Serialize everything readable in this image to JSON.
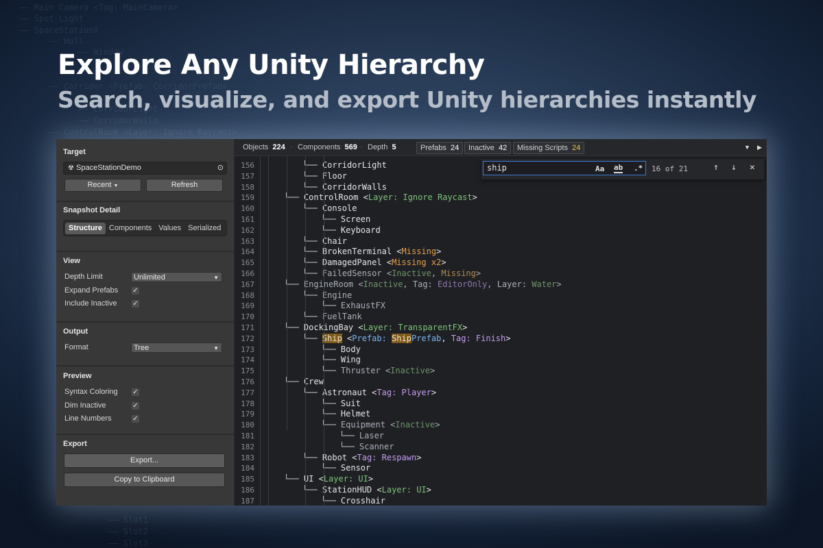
{
  "background_tree": [
    "—— Main Camera <Tag: MainCamera>",
    "—— Spot Light",
    "—— SpaceStationX",
    "      —— Hull",
    "            —— Window",
    "      —— Corridor <Prefab: CorridorPrefab>",
    "            —— CorridorLight",
    "            —— CorridorWalls",
    "      —— ControlRoom <Layer: Ignore Raycast>",
    "                  —— Slot1",
    "                  —— Slot2",
    "                  —— Slot3"
  ],
  "hero": {
    "title": "Explore Any Unity Hierarchy",
    "subtitle": "Search, visualize, and export Unity hierarchies instantly"
  },
  "sidebar": {
    "target": {
      "title": "Target",
      "object": "SpaceStationDemo",
      "recent_label": "Recent",
      "refresh_label": "Refresh"
    },
    "snapshot": {
      "title": "Snapshot Detail",
      "tabs": [
        "Structure",
        "Components",
        "Values",
        "Serialized"
      ],
      "active": "Structure"
    },
    "view": {
      "title": "View",
      "depth_label": "Depth Limit",
      "depth_value": "Unlimited",
      "expand_prefabs_label": "Expand Prefabs",
      "include_inactive_label": "Include Inactive"
    },
    "output": {
      "title": "Output",
      "format_label": "Format",
      "format_value": "Tree"
    },
    "preview": {
      "title": "Preview",
      "syntax_label": "Syntax Coloring",
      "dim_label": "Dim Inactive",
      "line_numbers_label": "Line Numbers"
    },
    "export": {
      "title": "Export",
      "export_label": "Export...",
      "copy_label": "Copy to Clipboard"
    },
    "checkmark": "✓"
  },
  "toolbar": {
    "objects_label": "Objects",
    "objects_value": "224",
    "components_label": "Components",
    "components_value": "569",
    "depth_label": "Depth",
    "depth_value": "5",
    "prefabs_label": "Prefabs",
    "prefabs_value": "24",
    "inactive_label": "Inactive",
    "inactive_value": "42",
    "missing_label": "Missing Scripts",
    "missing_value": "24",
    "separator": "·"
  },
  "find": {
    "query": "ship",
    "match_case": "Aa",
    "whole_word": "ab",
    "regex": ".*",
    "count": "16 of 21",
    "prev": "↑",
    "next": "↓",
    "close": "✕"
  },
  "colors": {
    "accent": "#3d7fd6",
    "green": "#7ec27a",
    "orange": "#e7a24a",
    "purple": "#c49bf0",
    "blue": "#79b4f0",
    "warning": "#e8c84a"
  },
  "lines": [
    {
      "n": "156",
      "d": 3,
      "seg": [
        [
          "t",
          "CorridorLight"
        ]
      ]
    },
    {
      "n": "157",
      "d": 3,
      "seg": [
        [
          "t",
          "Floor"
        ]
      ]
    },
    {
      "n": "158",
      "d": 3,
      "last": true,
      "seg": [
        [
          "t",
          "CorridorWalls"
        ]
      ]
    },
    {
      "n": "159",
      "d": 2,
      "seg": [
        [
          "t",
          "ControlRoom "
        ],
        [
          "p",
          "<"
        ],
        [
          "g",
          "Layer: Ignore Raycast"
        ],
        [
          "p",
          ">"
        ]
      ]
    },
    {
      "n": "160",
      "d": 3,
      "seg": [
        [
          "t",
          "Console"
        ]
      ]
    },
    {
      "n": "161",
      "d": 4,
      "seg": [
        [
          "t",
          "Screen"
        ]
      ]
    },
    {
      "n": "162",
      "d": 4,
      "last": true,
      "seg": [
        [
          "t",
          "Keyboard"
        ]
      ]
    },
    {
      "n": "163",
      "d": 3,
      "seg": [
        [
          "t",
          "Chair"
        ]
      ]
    },
    {
      "n": "164",
      "d": 3,
      "seg": [
        [
          "t",
          "BrokenTerminal "
        ],
        [
          "p",
          "<"
        ],
        [
          "o",
          "Missing"
        ],
        [
          "p",
          ">"
        ]
      ]
    },
    {
      "n": "165",
      "d": 3,
      "seg": [
        [
          "t",
          "DamagedPanel "
        ],
        [
          "p",
          "<"
        ],
        [
          "o",
          "Missing x2"
        ],
        [
          "p",
          ">"
        ]
      ]
    },
    {
      "n": "166",
      "d": 3,
      "last": true,
      "seg": [
        [
          "di",
          "FailedSensor "
        ],
        [
          "dp",
          "<"
        ],
        [
          "dg",
          "Inactive"
        ],
        [
          "dp",
          ", "
        ],
        [
          "do",
          "Missing"
        ],
        [
          "dp",
          ">"
        ]
      ]
    },
    {
      "n": "167",
      "d": 2,
      "seg": [
        [
          "di",
          "EngineRoom "
        ],
        [
          "dp",
          "<"
        ],
        [
          "dg",
          "Inactive"
        ],
        [
          "dp",
          ", Tag: "
        ],
        [
          "dpu",
          "EditorOnly"
        ],
        [
          "dp",
          ", Layer: "
        ],
        [
          "dg",
          "Water"
        ],
        [
          "dp",
          ">"
        ]
      ]
    },
    {
      "n": "168",
      "d": 3,
      "seg": [
        [
          "di",
          "Engine"
        ]
      ]
    },
    {
      "n": "169",
      "d": 4,
      "last": true,
      "seg": [
        [
          "di",
          "ExhaustFX"
        ]
      ]
    },
    {
      "n": "170",
      "d": 3,
      "last": true,
      "seg": [
        [
          "di",
          "FuelTank"
        ]
      ]
    },
    {
      "n": "171",
      "d": 2,
      "seg": [
        [
          "t",
          "DockingBay "
        ],
        [
          "p",
          "<"
        ],
        [
          "g",
          "Layer: TransparentFX"
        ],
        [
          "p",
          ">"
        ]
      ]
    },
    {
      "n": "172",
      "d": 3,
      "last": true,
      "seg": [
        [
          "hl",
          "Ship"
        ],
        [
          "p",
          " <"
        ],
        [
          "b",
          "Prefab: "
        ],
        [
          "hl",
          "Ship"
        ],
        [
          "b",
          "Prefab"
        ],
        [
          "p",
          ", "
        ],
        [
          "pu",
          "Tag: Finish"
        ],
        [
          "p",
          ">"
        ]
      ]
    },
    {
      "n": "173",
      "d": 4,
      "seg": [
        [
          "t",
          "Body"
        ]
      ]
    },
    {
      "n": "174",
      "d": 4,
      "seg": [
        [
          "t",
          "Wing"
        ]
      ]
    },
    {
      "n": "175",
      "d": 4,
      "last": true,
      "seg": [
        [
          "di",
          "Thruster "
        ],
        [
          "dp",
          "<"
        ],
        [
          "dg",
          "Inactive"
        ],
        [
          "dp",
          ">"
        ]
      ]
    },
    {
      "n": "176",
      "d": 2,
      "seg": [
        [
          "t",
          "Crew"
        ]
      ]
    },
    {
      "n": "177",
      "d": 3,
      "seg": [
        [
          "t",
          "Astronaut "
        ],
        [
          "p",
          "<"
        ],
        [
          "pu",
          "Tag: Player"
        ],
        [
          "p",
          ">"
        ]
      ]
    },
    {
      "n": "178",
      "d": 4,
      "seg": [
        [
          "t",
          "Suit"
        ]
      ]
    },
    {
      "n": "179",
      "d": 4,
      "seg": [
        [
          "t",
          "Helmet"
        ]
      ]
    },
    {
      "n": "180",
      "d": 4,
      "last": true,
      "seg": [
        [
          "di",
          "Equipment "
        ],
        [
          "dp",
          "<"
        ],
        [
          "dg",
          "Inactive"
        ],
        [
          "dp",
          ">"
        ]
      ]
    },
    {
      "n": "181",
      "d": 5,
      "seg": [
        [
          "di",
          "Laser"
        ]
      ]
    },
    {
      "n": "182",
      "d": 5,
      "last": true,
      "seg": [
        [
          "di",
          "Scanner"
        ]
      ]
    },
    {
      "n": "183",
      "d": 3,
      "last": true,
      "seg": [
        [
          "t",
          "Robot "
        ],
        [
          "p",
          "<"
        ],
        [
          "pu",
          "Tag: Respawn"
        ],
        [
          "p",
          ">"
        ]
      ]
    },
    {
      "n": "184",
      "d": 4,
      "last": true,
      "seg": [
        [
          "t",
          "Sensor"
        ]
      ]
    },
    {
      "n": "185",
      "d": 2,
      "seg": [
        [
          "t",
          "UI "
        ],
        [
          "p",
          "<"
        ],
        [
          "g",
          "Layer: UI"
        ],
        [
          "p",
          ">"
        ]
      ]
    },
    {
      "n": "186",
      "d": 3,
      "last": true,
      "seg": [
        [
          "t",
          "StationHUD "
        ],
        [
          "p",
          "<"
        ],
        [
          "g",
          "Layer: UI"
        ],
        [
          "p",
          ">"
        ]
      ]
    },
    {
      "n": "187",
      "d": 4,
      "seg": [
        [
          "t",
          "Crosshair"
        ]
      ]
    }
  ]
}
